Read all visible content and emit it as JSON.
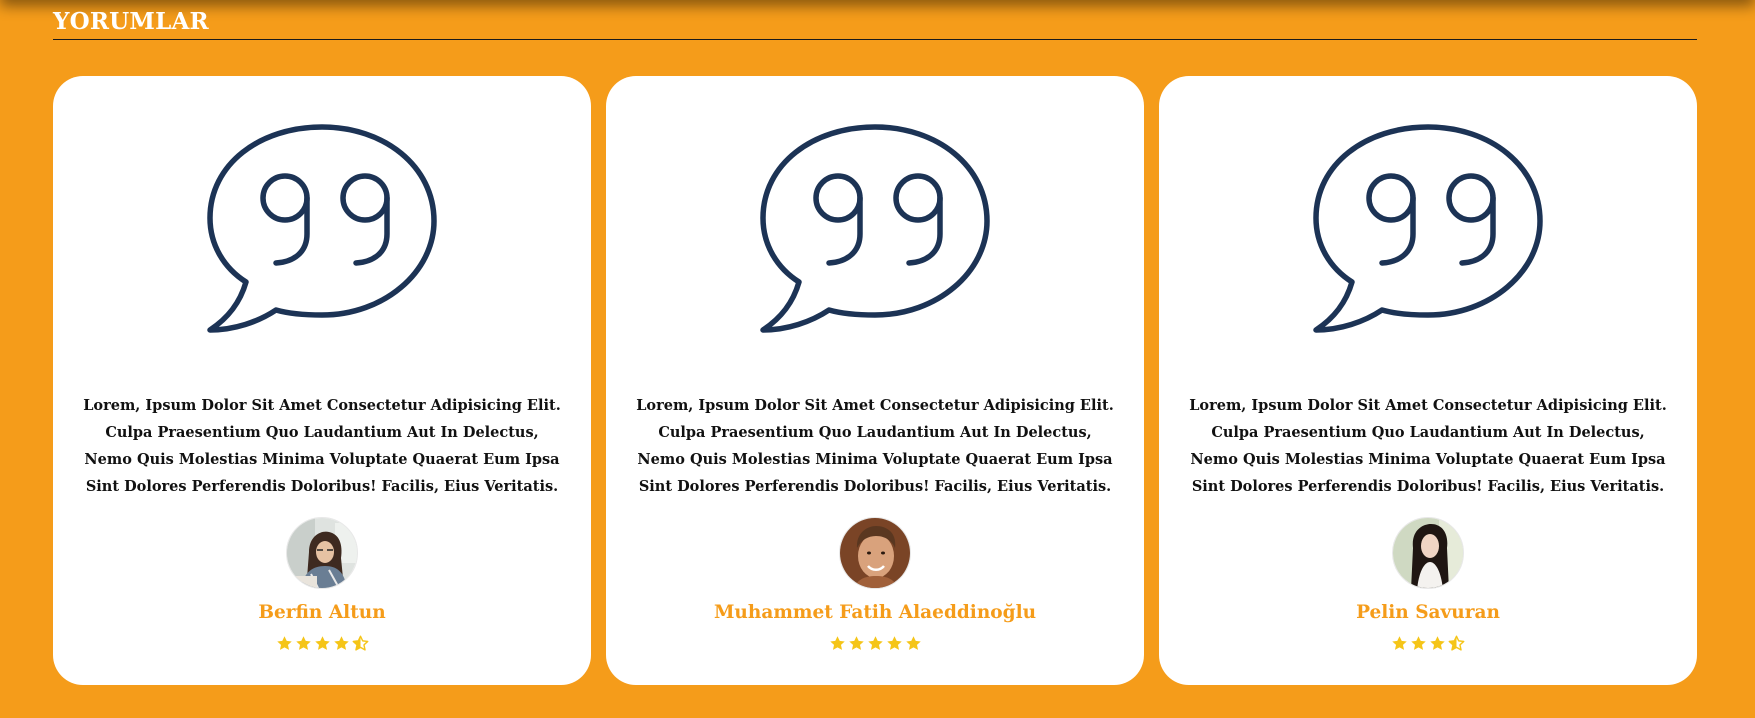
{
  "section": {
    "title": "YORUMLAR"
  },
  "colors": {
    "background": "#f59c1a",
    "accent": "#f59c1a",
    "star": "#f5c518",
    "icon": "#1c3355"
  },
  "reviews": [
    {
      "text": "Lorem, Ipsum Dolor Sit Amet Consectetur Adipisicing Elit. Culpa Praesentium Quo Laudantium Aut In Delectus, Nemo Quis Molestias Minima Voluptate Quaerat Eum Ipsa Sint Dolores Perferendis Doloribus! Facilis, Eius Veritatis.",
      "name": "Berfin Altun",
      "rating": 4.5,
      "avatar_icon": "woman-with-glasses-avatar"
    },
    {
      "text": "Lorem, Ipsum Dolor Sit Amet Consectetur Adipisicing Elit. Culpa Praesentium Quo Laudantium Aut In Delectus, Nemo Quis Molestias Minima Voluptate Quaerat Eum Ipsa Sint Dolores Perferendis Doloribus! Facilis, Eius Veritatis.",
      "name": "Muhammet Fatih Alaeddinoğlu",
      "rating": 5,
      "avatar_icon": "smiling-man-avatar"
    },
    {
      "text": "Lorem, Ipsum Dolor Sit Amet Consectetur Adipisicing Elit. Culpa Praesentium Quo Laudantium Aut In Delectus, Nemo Quis Molestias Minima Voluptate Quaerat Eum Ipsa Sint Dolores Perferendis Doloribus! Facilis, Eius Veritatis.",
      "name": "Pelin Savuran",
      "rating": 3.5,
      "avatar_icon": "woman-long-hair-avatar"
    }
  ]
}
